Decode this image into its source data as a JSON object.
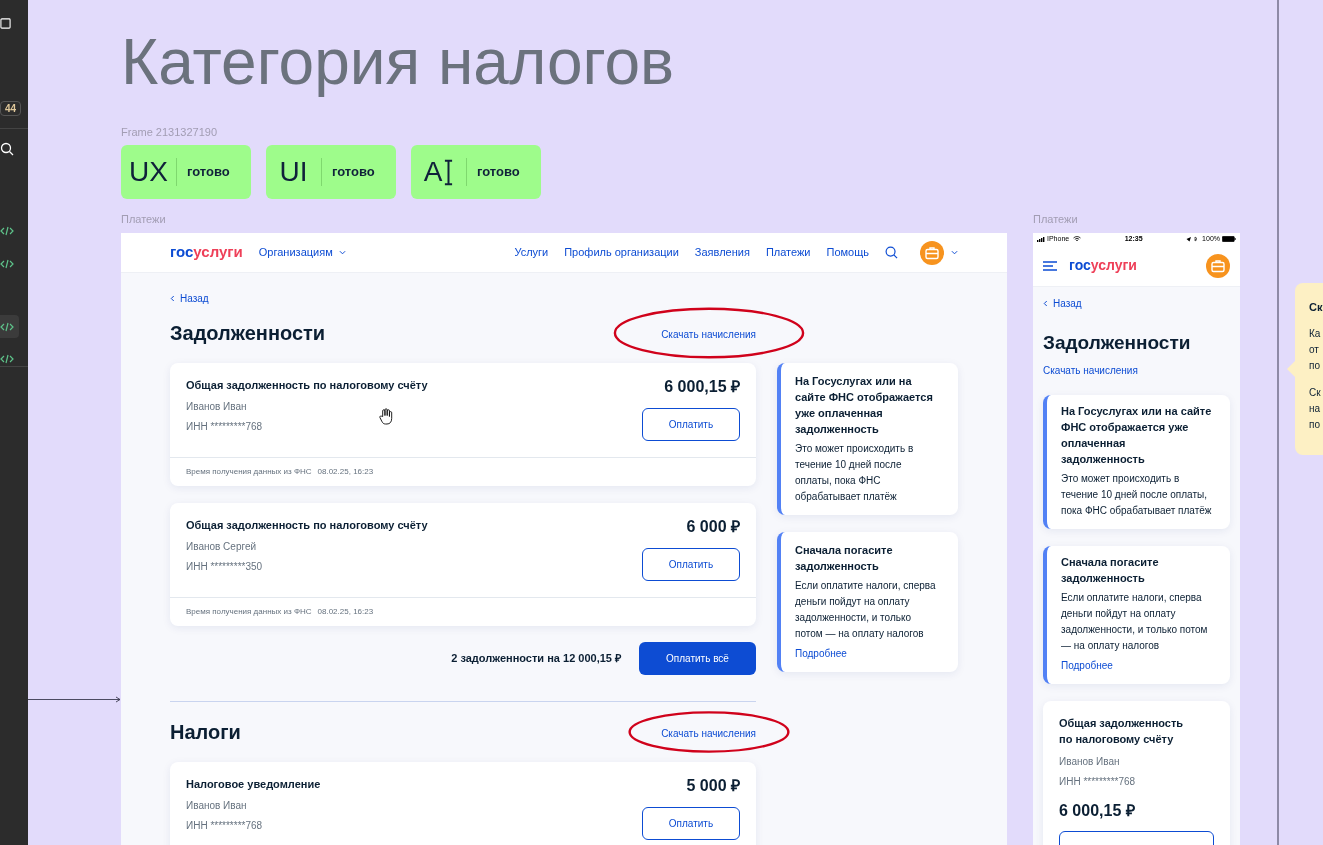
{
  "toolbar": {
    "badge": "44"
  },
  "canvas": {
    "title": "Категория налогов",
    "frame_label": "Frame 2131327190",
    "status_badges": [
      {
        "code": "UX",
        "cursor": false,
        "status": "готово"
      },
      {
        "code": "UI",
        "cursor": false,
        "status": "готово"
      },
      {
        "code": "A",
        "cursor": true,
        "status": "готово"
      }
    ]
  },
  "desktop": {
    "frame_label": "Платежи",
    "header": {
      "logo": [
        "гос",
        "услуги"
      ],
      "org_menu": "Организациям",
      "nav": [
        "Услуги",
        "Профиль организации",
        "Заявления",
        "Платежи",
        "Помощь"
      ]
    },
    "back": "Назад",
    "sections": [
      {
        "title": "Задолженности",
        "download_link": "Скачать начисления",
        "highlighted": true,
        "cards": [
          {
            "title": "Общая задолженность по налоговому счёту",
            "name": "Иванов Иван",
            "inn": "ИНН *********768",
            "amount": "6 000,15 ₽",
            "button": "Оплатить",
            "footer": [
              "Время получения данных из ФНС",
              "08.02.25, 16:23"
            ]
          },
          {
            "title": "Общая задолженность по налоговому счёту",
            "name": "Иванов Сергей",
            "inn": "ИНН *********350",
            "amount": "6 000 ₽",
            "button": "Оплатить",
            "footer": [
              "Время получения данных из ФНС",
              "08.02.25, 16:23"
            ]
          }
        ],
        "summary": {
          "text": "2 задолженности на 12 000,15 ₽",
          "button": "Оплатить всё"
        }
      },
      {
        "title": "Налоги",
        "download_link": "Скачать начисления",
        "highlighted": true,
        "cards": [
          {
            "title": "Налоговое уведомление",
            "name": "Иванов Иван",
            "inn": "ИНН *********768",
            "amount": "5 000 ₽",
            "button": "Оплатить"
          }
        ]
      }
    ],
    "notes": [
      {
        "title": "На Госуслугах или на сайте ФНС отображается уже оплаченная задолженность",
        "text": "Это может происходить в течение 10 дней после оплаты, пока ФНС обрабатывает платёж"
      },
      {
        "title": "Сначала погасите задолженность",
        "text": "Если оплатите налоги, сперва деньги пойдут на оплату задолженности, и только потом — на оплату налогов",
        "link": "Подробнее"
      }
    ]
  },
  "mobile": {
    "frame_label": "Платежи",
    "status_bar": {
      "carrier": "IPhone",
      "time": "12:35",
      "battery": "100%"
    },
    "logo": [
      "гос",
      "услуги"
    ],
    "back": "Назад",
    "title": "Задолженности",
    "download_link": "Скачать начисления",
    "notes": [
      {
        "title": "На Госуслугах или на сайте ФНС отображается уже оплаченная задолженность",
        "text": "Это может происходить в течение 10 дней после оплаты, пока ФНС обрабатывает платёж"
      },
      {
        "title": "Сначала погасите задолженность",
        "text": "Если оплатите налоги, сперва деньги пойдут на оплату задолженности, и только потом — на оплату налогов",
        "link": "Подробнее"
      }
    ],
    "cards": [
      {
        "title": "Общая задолженность по налоговому счёту",
        "name": "Иванов Иван",
        "inn": "ИНН *********768",
        "amount": "6 000,15 ₽"
      }
    ]
  },
  "comment": {
    "title": "Ск",
    "lines": [
      "Ка",
      "от",
      "по",
      "Ск",
      "на",
      "по"
    ]
  }
}
